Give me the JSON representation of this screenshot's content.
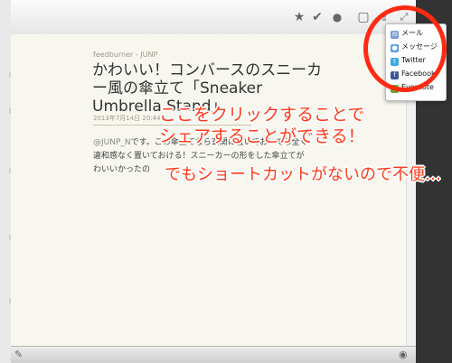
{
  "toolbar": {
    "icons": [
      "star-icon",
      "check-icon",
      "tortoise-icon",
      "note-icon",
      "share-icon",
      "expand-icon"
    ]
  },
  "article": {
    "source": "feedburner - JUNP",
    "title": "かわいい！コンバースのスニーカー風の傘立て「Sneaker Umbrella Stand」",
    "date": "2013年7月14日 20:44",
    "body_mention": "@JUNP_N",
    "body_text": "です。この傘立てなら玄関に置いておいても全く違和感なく置いておける！スニーカーの形をした傘立てがわいいかったの"
  },
  "share_menu": {
    "items": [
      {
        "label": "メール",
        "icon": "mail-icon",
        "color": "#7a9bd6"
      },
      {
        "label": "メッセージ",
        "icon": "messages-icon",
        "color": "#5aa0e6"
      },
      {
        "label": "Twitter",
        "icon": "twitter-icon",
        "color": "#3aa8e8"
      },
      {
        "label": "Facebook",
        "icon": "facebook-icon",
        "color": "#3b5998"
      },
      {
        "label": "Evernote",
        "icon": "evernote-icon",
        "color": "#5bb030"
      }
    ]
  },
  "annotations": {
    "line1": "ここをクリックすることで",
    "line2": "シェアすることができる！",
    "line3": "でもショートカットがないので不便…"
  },
  "colors": {
    "annotation": "#ff3a1a",
    "circle": "#ff2a12",
    "content_bg": "#f7f6ef"
  }
}
